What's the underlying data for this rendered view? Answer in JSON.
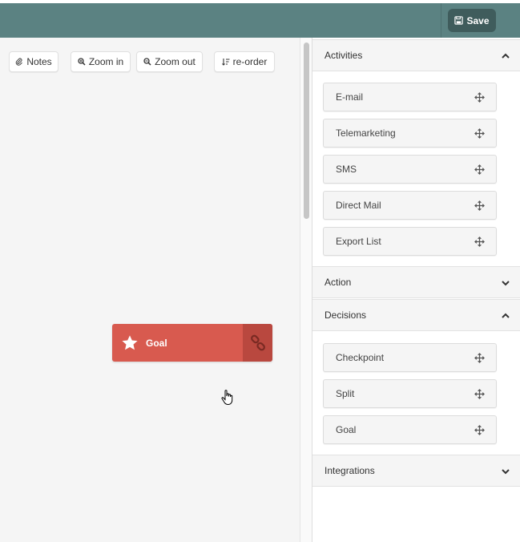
{
  "topbar": {
    "save_label": "Save"
  },
  "toolbar": {
    "notes_label": "Notes",
    "zoom_in_label": "Zoom in",
    "zoom_out_label": "Zoom out",
    "reorder_label": "re-order"
  },
  "canvas": {
    "node": {
      "label": "Goal",
      "color": "#d85a4f",
      "link_color": "#b9483f"
    }
  },
  "sidebar": {
    "activities": {
      "title": "Activities",
      "items": [
        "E-mail",
        "Telemarketing",
        "SMS",
        "Direct Mail",
        "Export List"
      ]
    },
    "action": {
      "title": "Action"
    },
    "decisions": {
      "title": "Decisions",
      "items": [
        "Checkpoint",
        "Split",
        "Goal"
      ]
    },
    "integrations": {
      "title": "Integrations"
    }
  },
  "colors": {
    "topbar": "#5b8282",
    "save_button": "#3f5c5c"
  }
}
